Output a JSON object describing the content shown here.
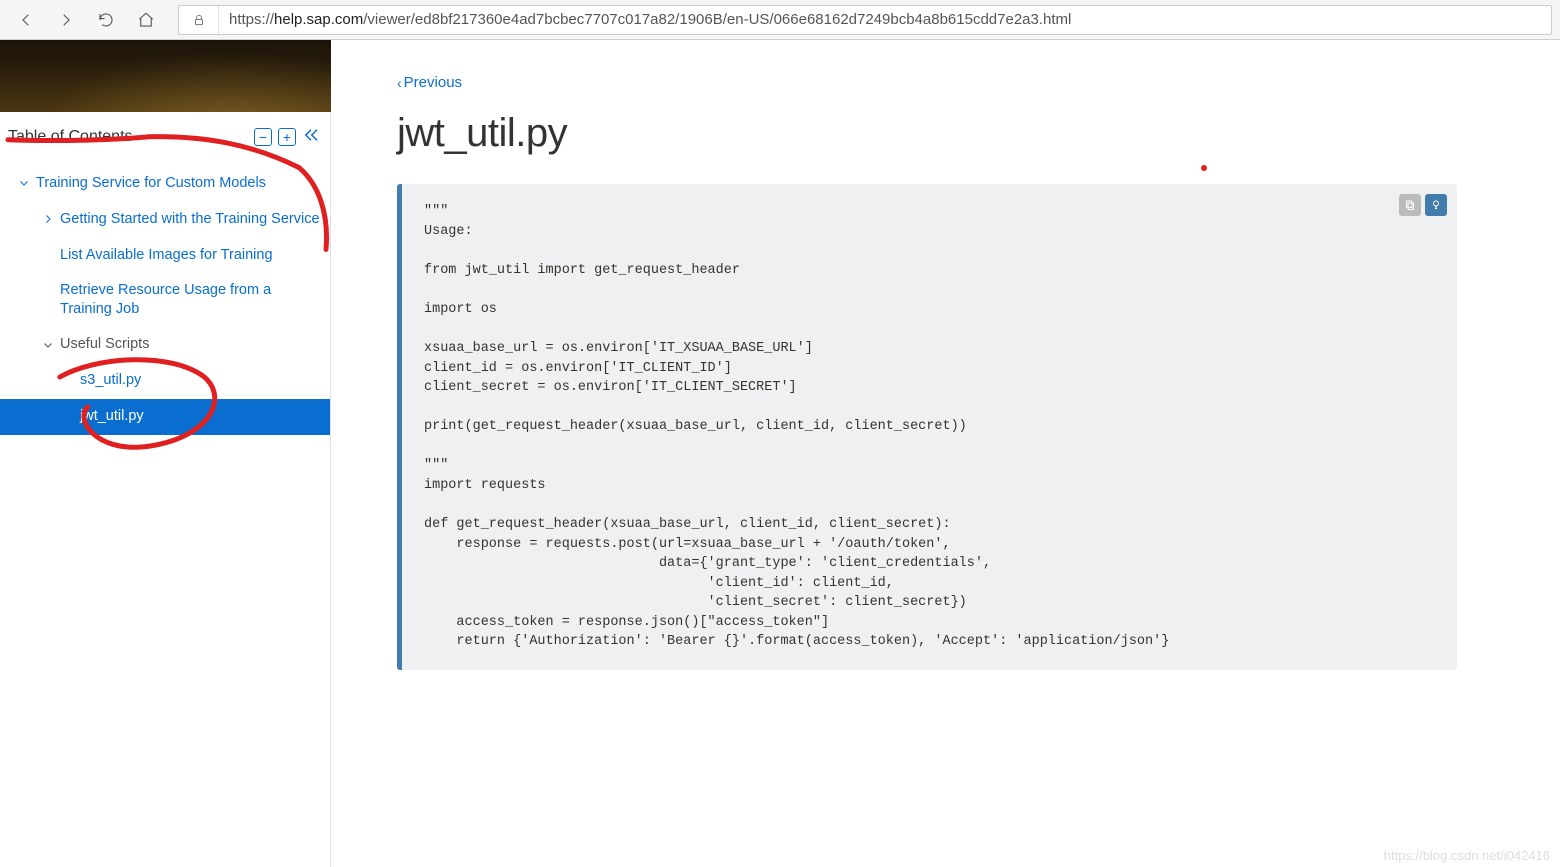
{
  "browser": {
    "url_prefix": "https://",
    "url_host": "help.sap.com",
    "url_path": "/viewer/ed8bf217360e4ad7bcbec7707c017a82/1906B/en-US/066e68162d7249bcb4a8b615cdd7e2a3.html"
  },
  "sidebar": {
    "title": "Table of Contents",
    "items": {
      "l1": "Training Service for Custom Models",
      "l2a": "Getting Started with the Training Service",
      "l2b": "List Available Images for Training",
      "l2c": "Retrieve Resource Usage from a Training Job",
      "l2d": "Useful Scripts",
      "l3a": "s3_util.py",
      "l3b": "jwt_util.py"
    }
  },
  "article": {
    "previous": "Previous",
    "title": "jwt_util.py",
    "code": "\"\"\"\nUsage:\n\nfrom jwt_util import get_request_header\n\nimport os\n\nxsuaa_base_url = os.environ['IT_XSUAA_BASE_URL']\nclient_id = os.environ['IT_CLIENT_ID']\nclient_secret = os.environ['IT_CLIENT_SECRET']\n\nprint(get_request_header(xsuaa_base_url, client_id, client_secret))\n\n\"\"\"\nimport requests\n\ndef get_request_header(xsuaa_base_url, client_id, client_secret):\n    response = requests.post(url=xsuaa_base_url + '/oauth/token',\n                             data={'grant_type': 'client_credentials',\n                                   'client_id': client_id,\n                                   'client_secret': client_secret})\n    access_token = response.json()[\"access_token\"]\n    return {'Authorization': 'Bearer {}'.format(access_token), 'Accept': 'application/json'}"
  },
  "watermark": "https://blog.csdn.net/i042416"
}
